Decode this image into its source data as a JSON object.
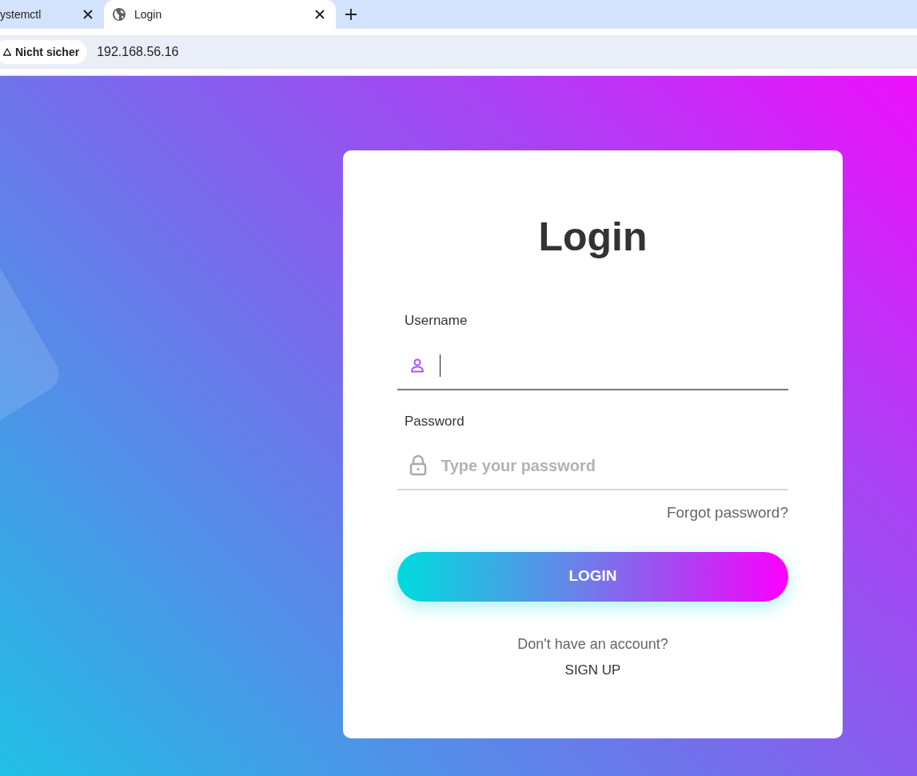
{
  "browser": {
    "tabs": [
      {
        "label": "ystemctl",
        "selected": false
      },
      {
        "label": "Login",
        "selected": true
      }
    ],
    "security": "Nicht sicher",
    "url": "192.168.56.16"
  },
  "login": {
    "title": "Login",
    "fields": [
      {
        "kind": "user",
        "label": "Username",
        "focused": true
      },
      {
        "kind": "password",
        "label": "Password",
        "placeholder": "Type your password",
        "focused": false
      }
    ],
    "forgot": "Forgot password?",
    "button": "LOGIN",
    "signup_prompt": "Don't have an account?",
    "signup": "SIGN UP"
  }
}
